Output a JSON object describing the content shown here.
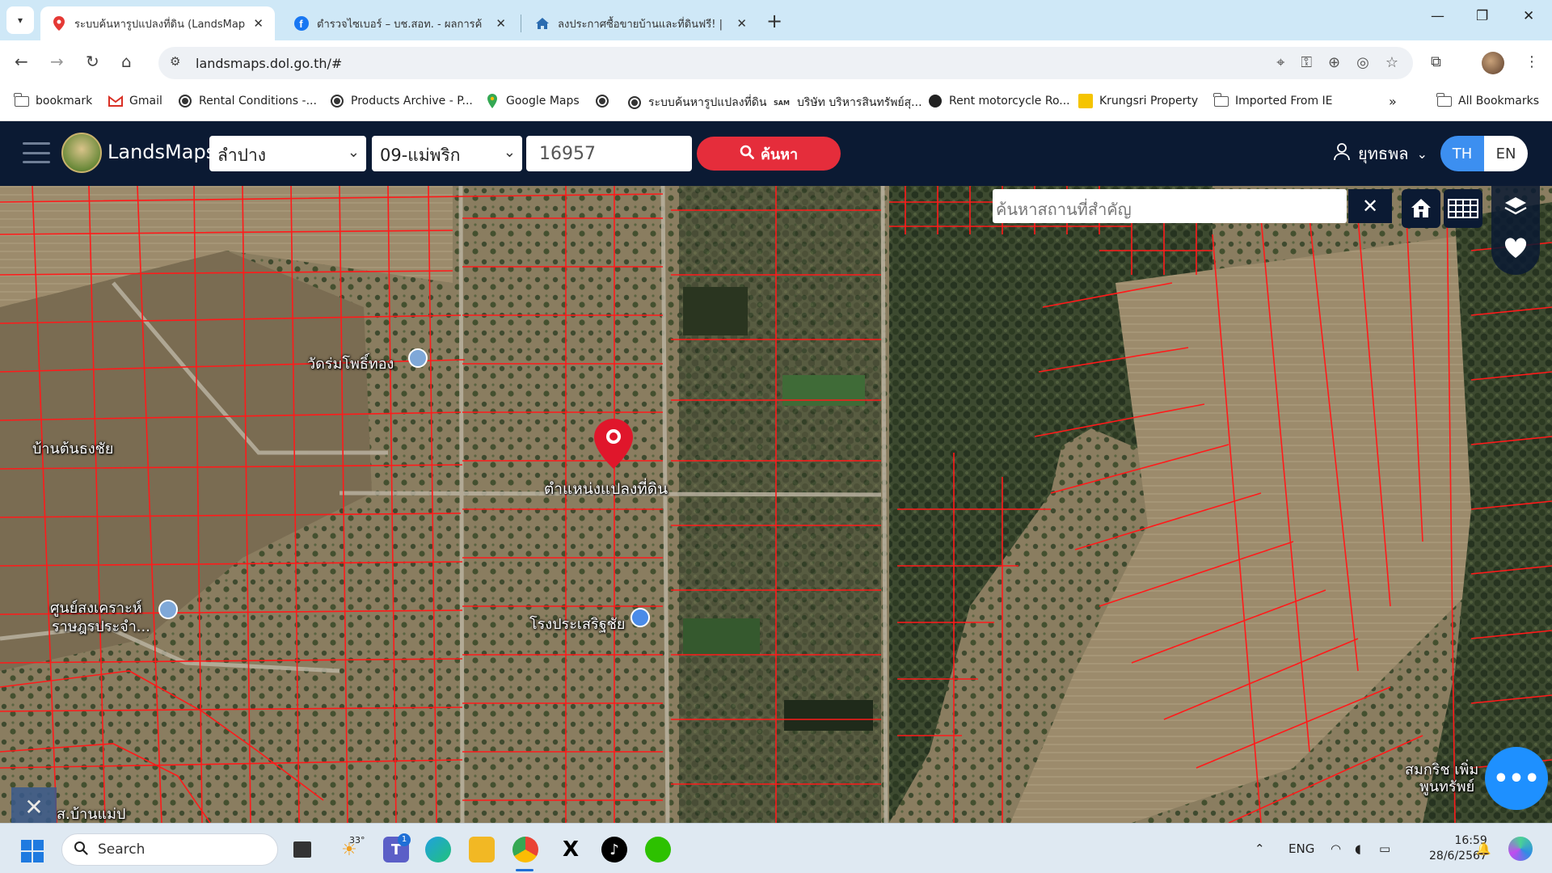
{
  "browser": {
    "tabs": [
      {
        "title": "ระบบค้นหารูปแปลงที่ดิน (LandsMap",
        "active": true,
        "icon": "map-pin-icon"
      },
      {
        "title": "ตำรวจไซเบอร์ – บช.สอท. - ผลการค้",
        "active": false,
        "icon": "facebook-icon"
      },
      {
        "title": "ลงประกาศซื้อขายบ้านและที่ดินฟรี! | ",
        "active": false,
        "icon": "house-icon"
      }
    ],
    "url": "landsmaps.dol.go.th/#",
    "bookmarks": [
      {
        "label": "bookmark",
        "icon": "folder-icon"
      },
      {
        "label": "Gmail",
        "icon": "gmail-icon"
      },
      {
        "label": "Rental Conditions -...",
        "icon": "globe-icon"
      },
      {
        "label": "Products Archive - P...",
        "icon": "globe-icon"
      },
      {
        "label": "Google Maps",
        "icon": "google-maps-icon"
      },
      {
        "label": "",
        "icon": "globe-icon"
      },
      {
        "label": "ระบบค้นหารูปแปลงที่ดิน",
        "icon": "globe-icon"
      },
      {
        "label": "บริษัท บริหารสินทรัพย์สุ...",
        "icon": "sam-icon"
      },
      {
        "label": "Rent motorcycle Ro...",
        "icon": "moto-icon"
      },
      {
        "label": "Krungsri Property",
        "icon": "krungsri-icon"
      },
      {
        "label": "Imported From IE",
        "icon": "folder-icon"
      }
    ],
    "all_bookmarks": "All Bookmarks"
  },
  "app": {
    "name": "LandsMaps",
    "province": "ลำปาง",
    "district": "09-แม่พริก",
    "parcel_number": "16957",
    "search_label": "ค้นหา",
    "user": "ยุทธพล",
    "lang_th": "TH",
    "lang_en": "EN"
  },
  "map": {
    "place_search_placeholder": "ค้นหาสถานที่สำคัญ",
    "marker_label": "ตำแหน่งแปลงที่ดิน",
    "labels": [
      {
        "text": "วัดร่มโพธิ์ทอง"
      },
      {
        "text": "บ้านต้นธงชัย"
      },
      {
        "text": "ศูนย์สงเคราะห์"
      },
      {
        "text": "ราษฎรประจำ..."
      },
      {
        "text": "โรงประเสริฐชัย"
      },
      {
        "text": "สมกริช เพิ่ม"
      },
      {
        "text": "พูนทรัพย์"
      },
      {
        "text": "ส.บ้านแม่ป"
      }
    ]
  },
  "taskbar": {
    "search_placeholder": "Search",
    "weather": "33°",
    "badge_count": "1",
    "lang": "ENG",
    "time": "16:59",
    "date": "28/6/2567"
  },
  "colors": {
    "header_bg": "#0b1a33",
    "accent_red": "#e52d3b",
    "accent_blue": "#3c8ff0",
    "parcel_line": "#ff1a1a"
  }
}
